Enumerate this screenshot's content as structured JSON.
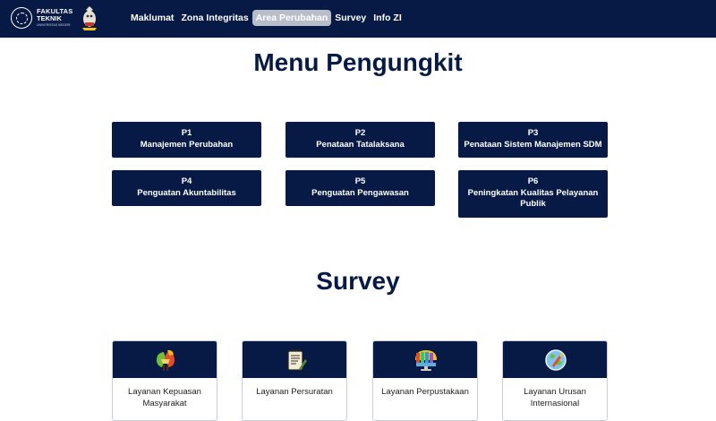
{
  "header": {
    "logo": {
      "line1": "FAKULTAS",
      "line2": "TEKNIK",
      "line3": "UNIVERSITAS NEGERI"
    },
    "nav": [
      {
        "label": "Maklumat",
        "active": false
      },
      {
        "label": "Zona Integritas",
        "active": false
      },
      {
        "label": "Area Perubahan",
        "active": true
      },
      {
        "label": "Survey",
        "active": false
      },
      {
        "label": "Info ZI",
        "active": false
      }
    ]
  },
  "menu": {
    "title": "Menu Pengungkit",
    "items": [
      {
        "code": "P1",
        "label": "Manajemen Perubahan"
      },
      {
        "code": "P2",
        "label": "Penataan Tatalaksana"
      },
      {
        "code": "P3",
        "label": "Penataan Sistem Manajemen SDM"
      },
      {
        "code": "P4",
        "label": "Penguatan Akuntabilitas"
      },
      {
        "code": "P5",
        "label": "Penguatan Pengawasan"
      },
      {
        "code": "P6",
        "label": "Peningkatan Kualitas Pelayanan Publik"
      }
    ]
  },
  "survey": {
    "title": "Survey",
    "cards": [
      {
        "label": "Layanan Kepuasan Masyarakat",
        "icon": "handshake-icon"
      },
      {
        "label": "Layanan Persuratan",
        "icon": "document-icon"
      },
      {
        "label": "Layanan Perpustakaan",
        "icon": "monitor-icon"
      },
      {
        "label": "Layanan Urusan Internasional",
        "icon": "globe-icon"
      }
    ]
  },
  "colors": {
    "primary": "#061a45",
    "active_nav": "#b8bec9"
  }
}
